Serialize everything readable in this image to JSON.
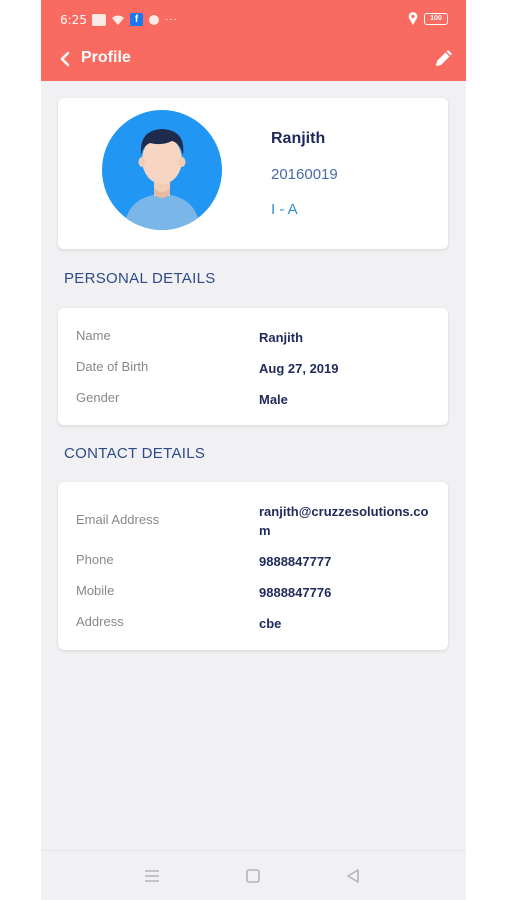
{
  "status_bar": {
    "time": "6:25",
    "battery": "100"
  },
  "app_bar": {
    "title": "Profile",
    "icons": {
      "back": "back-chevron-icon",
      "edit": "pencil-edit-icon"
    }
  },
  "profile": {
    "name": "Ranjith",
    "id": "20160019",
    "class": "I - A",
    "avatar_icon": "user-avatar-icon"
  },
  "personal_details": {
    "title": "PERSONAL DETAILS",
    "rows": [
      {
        "label": "Name",
        "value": "Ranjith"
      },
      {
        "label": "Date of Birth",
        "value": "Aug 27, 2019"
      },
      {
        "label": "Gender",
        "value": "Male"
      }
    ]
  },
  "contact_details": {
    "title": "CONTACT DETAILS",
    "rows": [
      {
        "label": "Email Address",
        "value": "ranjith@cruzzesolutions.com"
      },
      {
        "label": "Phone",
        "value": "9888847777"
      },
      {
        "label": "Mobile",
        "value": "9888847776"
      },
      {
        "label": "Address",
        "value": "cbe"
      }
    ]
  },
  "colors": {
    "header": "#f96b60",
    "background": "#f1f1f3",
    "primary_text": "#1f2a5a",
    "section_title": "#2d4a8a",
    "accent_blue": "#2f8fd9",
    "avatar_bg": "#2196f3"
  }
}
